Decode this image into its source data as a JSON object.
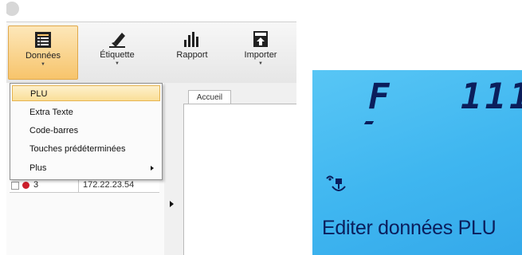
{
  "ribbon": {
    "buttons": [
      {
        "label": "Données",
        "icon": "list-icon",
        "has_dropdown": true,
        "active": true
      },
      {
        "label": "Étiquette",
        "icon": "highlighter-icon",
        "has_dropdown": true,
        "active": false
      },
      {
        "label": "Rapport",
        "icon": "bar-chart-icon",
        "has_dropdown": false,
        "active": false
      },
      {
        "label": "Importer",
        "icon": "import-icon",
        "has_dropdown": true,
        "active": false
      }
    ]
  },
  "menu": {
    "items": [
      {
        "label": "PLU",
        "selected": true,
        "submenu": false
      },
      {
        "label": "Extra Texte",
        "selected": false,
        "submenu": false
      },
      {
        "label": "Code-barres",
        "selected": false,
        "submenu": false
      },
      {
        "label": "Touches prédéterminées",
        "selected": false,
        "submenu": false
      },
      {
        "label": "Plus",
        "selected": false,
        "submenu": true
      }
    ]
  },
  "tabs": [
    {
      "label": "Accueil"
    }
  ],
  "grid": {
    "row_partial": [
      "3",
      "172.22.23.54"
    ]
  },
  "lcd": {
    "top_left": "F",
    "top_right": "111",
    "message": "Editer données PLU",
    "colors": {
      "background": "#3fb6f0",
      "segments": "#0b1e5c"
    }
  },
  "colors": {
    "accent": "#f7c46b",
    "status_dot": "#cc1e2b"
  }
}
